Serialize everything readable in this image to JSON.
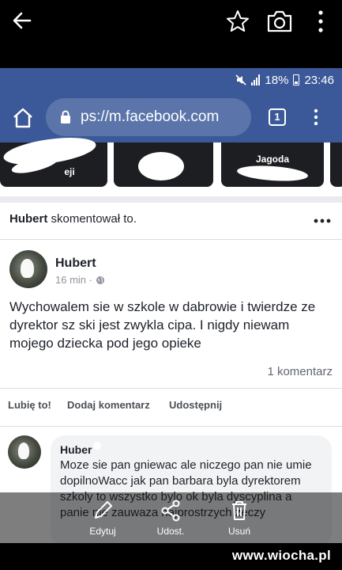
{
  "status_bar": {
    "battery": "18%",
    "time": "23:46"
  },
  "browser": {
    "url": "ps://m.facebook.com",
    "tab_count": "1"
  },
  "stories": [
    {
      "label": "eji"
    },
    {
      "label": ""
    },
    {
      "label": "Jagoda"
    }
  ],
  "activity": {
    "name": "Hubert ",
    "action": " skomentował to."
  },
  "post": {
    "author": "Hubert ",
    "time": "16 min · ",
    "text": "Wychowalem sie w szkole w dabrowie i twierdze ze dyrektor sz  ski jest zwykla cipa. I nigdy niewam mojego dziecka pod jego opieke",
    "comment_count": "1 komentarz"
  },
  "actions": {
    "like": "Lubię to!",
    "comment": "Dodaj komentarz",
    "share": "Udostępnij"
  },
  "comment": {
    "author": "Huber",
    "text": "Moze sie pan gniewac ale niczego pan nie umie dopilnoWacc jak pan barbara byla dyrektorem szkoly to wszystko bylo ok byla dyscyplina a panie nie zauwaza najprostrzych zeczy"
  },
  "overlay": {
    "edit": "Edytuj",
    "share": "Udost.",
    "delete": "Usuń"
  },
  "watermark": "www.wiocha.pl",
  "colors": {
    "facebook_blue": "#3b5998",
    "url_bar": "#5b75ab"
  }
}
